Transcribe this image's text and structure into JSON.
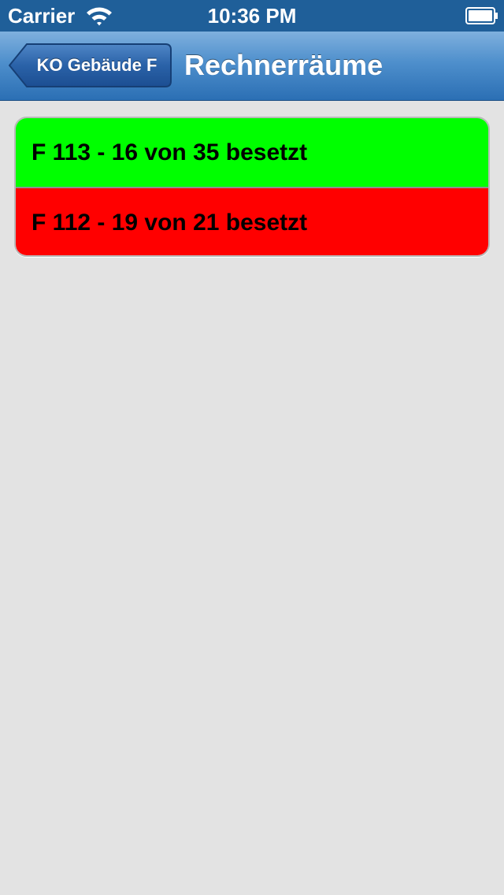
{
  "status_bar": {
    "carrier": "Carrier",
    "time": "10:36 PM",
    "wifi_icon": "wifi-icon",
    "battery_icon": "battery-icon"
  },
  "nav_bar": {
    "back_label": "KO Gebäude F",
    "title": "Rechnerräume"
  },
  "rooms": [
    {
      "label": "F 113 - 16 von 35 besetzt",
      "color": "#00ff00"
    },
    {
      "label": "F 112 - 19 von 21 besetzt",
      "color": "#ff0000"
    }
  ]
}
